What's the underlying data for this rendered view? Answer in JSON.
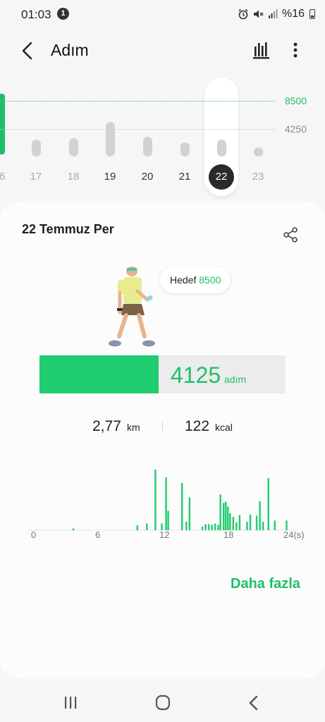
{
  "status_bar": {
    "time": "01:03",
    "notification_count": "1",
    "battery": "%16",
    "icons": [
      "alarm-icon",
      "mute-icon",
      "signal-icon",
      "battery-icon"
    ]
  },
  "header": {
    "title": "Adım",
    "icons": [
      "back-arrow-icon",
      "bar-chart-icon",
      "more-vert-icon"
    ]
  },
  "weekly_chart": {
    "goal_label": "8500",
    "mid_label": "4250",
    "days": [
      {
        "label": "6",
        "value": null
      },
      {
        "label": "17",
        "value": 2550
      },
      {
        "label": "18",
        "value": 2850
      },
      {
        "label": "19",
        "value": 5300
      },
      {
        "label": "20",
        "value": 3000
      },
      {
        "label": "21",
        "value": 2100
      },
      {
        "label": "22",
        "value": 2550
      },
      {
        "label": "23",
        "value": 0
      }
    ],
    "selected_day": "22"
  },
  "card": {
    "date_title": "22 Temmuz Per",
    "goal_bubble_label": "Hedef",
    "goal_bubble_value": "8500",
    "steps_value": "4125",
    "steps_unit": "adım",
    "progress_fraction": 0.485,
    "distance_value": "2,77",
    "distance_unit": "km",
    "calories_value": "122",
    "calories_unit": "kcal",
    "more_link": "Daha fazla",
    "icons": [
      "share-icon",
      "walking-person-illustration"
    ]
  },
  "chart_data": {
    "type": "bar",
    "x_tick_labels": [
      "0",
      "6",
      "12",
      "18",
      "24(s)"
    ],
    "xlim": [
      0,
      24
    ],
    "bars": [
      {
        "x": 0.3,
        "v": 0.01
      },
      {
        "x": 1.0,
        "v": 0.01
      },
      {
        "x": 1.7,
        "v": 0.01
      },
      {
        "x": 2.4,
        "v": 0.01
      },
      {
        "x": 3.0,
        "v": 0.01
      },
      {
        "x": 3.7,
        "v": 0.03
      },
      {
        "x": 4.3,
        "v": 0.01
      },
      {
        "x": 5.0,
        "v": 0.01
      },
      {
        "x": 6.7,
        "v": 0.01
      },
      {
        "x": 7.4,
        "v": 0.01
      },
      {
        "x": 8.1,
        "v": 0.01
      },
      {
        "x": 8.8,
        "v": 0.01
      },
      {
        "x": 9.7,
        "v": 0.08
      },
      {
        "x": 10.6,
        "v": 0.11
      },
      {
        "x": 11.4,
        "v": 1.0
      },
      {
        "x": 12.0,
        "v": 0.11
      },
      {
        "x": 12.4,
        "v": 0.87
      },
      {
        "x": 12.6,
        "v": 0.32
      },
      {
        "x": 13.9,
        "v": 0.78
      },
      {
        "x": 14.3,
        "v": 0.14
      },
      {
        "x": 14.6,
        "v": 0.54
      },
      {
        "x": 15.8,
        "v": 0.06
      },
      {
        "x": 16.1,
        "v": 0.1
      },
      {
        "x": 16.4,
        "v": 0.1
      },
      {
        "x": 16.7,
        "v": 0.09
      },
      {
        "x": 17.0,
        "v": 0.11
      },
      {
        "x": 17.3,
        "v": 0.09
      },
      {
        "x": 17.5,
        "v": 0.59
      },
      {
        "x": 17.8,
        "v": 0.45
      },
      {
        "x": 18.0,
        "v": 0.47
      },
      {
        "x": 18.2,
        "v": 0.39
      },
      {
        "x": 18.4,
        "v": 0.28
      },
      {
        "x": 18.7,
        "v": 0.22
      },
      {
        "x": 19.0,
        "v": 0.13
      },
      {
        "x": 19.3,
        "v": 0.25
      },
      {
        "x": 20.0,
        "v": 0.14
      },
      {
        "x": 20.3,
        "v": 0.26
      },
      {
        "x": 20.9,
        "v": 0.24
      },
      {
        "x": 21.2,
        "v": 0.48
      },
      {
        "x": 21.5,
        "v": 0.14
      },
      {
        "x": 22.0,
        "v": 0.86
      },
      {
        "x": 22.6,
        "v": 0.16
      },
      {
        "x": 23.7,
        "v": 0.16
      }
    ]
  }
}
